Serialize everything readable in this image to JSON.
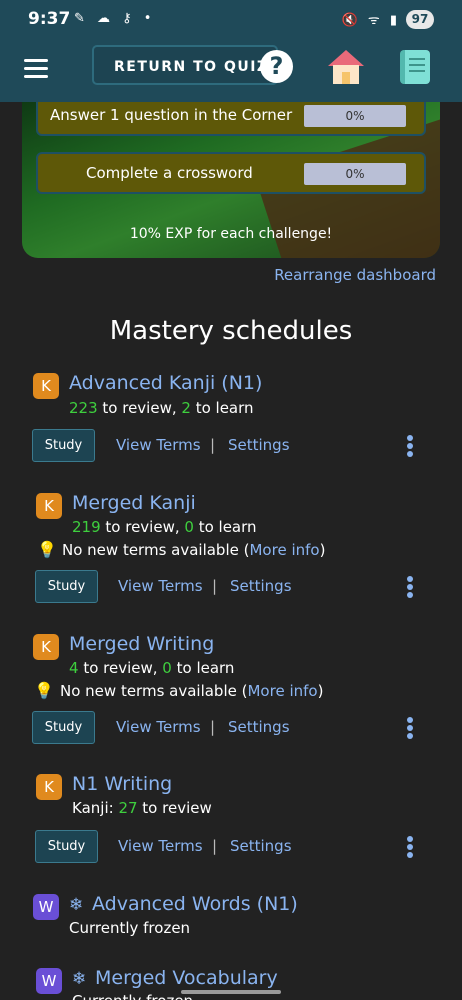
{
  "status": {
    "time": "9:37",
    "left_icons": "✎ ☁ ⚷ •",
    "right_icons": "🔇 ᯤ ▮",
    "battery": "97"
  },
  "nav": {
    "return_label": "RETURN TO QUIZ",
    "help_glyph": "?"
  },
  "challenges": [
    {
      "label": "Answer 1 question in the Corner",
      "progress": "0%"
    },
    {
      "label": "Complete a crossword",
      "progress": "0%"
    }
  ],
  "exp_note": "10% EXP for each challenge!",
  "rearrange": "Rearrange dashboard",
  "section_title": "Mastery schedules",
  "schedules": [
    {
      "badge": "K",
      "title": "Advanced Kanji (N1)",
      "review": "223",
      "review_text": " to review, ",
      "learn": "2",
      "learn_text": " to learn",
      "study": "Study",
      "view": "View Terms",
      "sep": "|",
      "settings": "Settings"
    },
    {
      "badge": "K",
      "title": "Merged Kanji",
      "review": "219",
      "review_text": " to review, ",
      "learn": "0",
      "learn_text": " to learn",
      "tip_pre": "No new terms available (",
      "tip_link": "More info",
      "tip_post": ")",
      "study": "Study",
      "view": "View Terms",
      "sep": "|",
      "settings": "Settings"
    },
    {
      "badge": "K",
      "title": "Merged Writing",
      "review": "4",
      "review_text": " to review, ",
      "learn": "0",
      "learn_text": " to learn",
      "tip_pre": "No new terms available (",
      "tip_link": "More info",
      "tip_post": ")",
      "study": "Study",
      "view": "View Terms",
      "sep": "|",
      "settings": "Settings"
    },
    {
      "badge": "K",
      "title": "N1 Writing",
      "kanji_label": "Kanji: ",
      "review": "27",
      "review_text": " to review",
      "study": "Study",
      "view": "View Terms",
      "sep": "|",
      "settings": "Settings"
    },
    {
      "badge": "W",
      "title": "Advanced Words (N1)",
      "frozen": "Currently frozen"
    },
    {
      "badge": "W",
      "title": "Merged Vocabulary",
      "frozen": "Currently frozen"
    }
  ],
  "icons": {
    "snow": "❄",
    "bulb": "💡"
  },
  "colors": {
    "nav": "#1f4a59",
    "link": "#8ab4f0",
    "count_green": "#3ecf3e",
    "badge_k": "#e08a1e",
    "badge_w": "#6a4fd6"
  }
}
